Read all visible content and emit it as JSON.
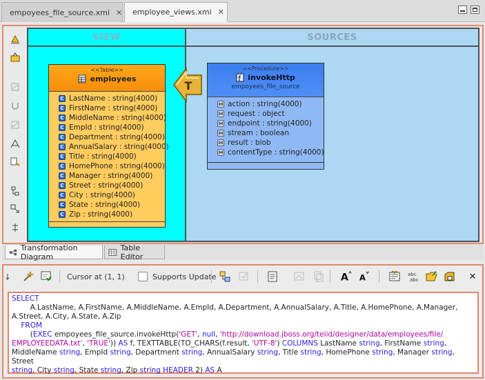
{
  "editor_tabs": [
    {
      "label": "empoyees_file_source.xmi",
      "active": false
    },
    {
      "label": "employee_views.xmi",
      "active": true
    }
  ],
  "diagram": {
    "view_header": "VIEW",
    "sources_header": "SOURCES",
    "table": {
      "stereotype": "<<Table>>",
      "name": "employees",
      "columns": [
        "LastName : string(4000)",
        "FirstName : string(4000)",
        "MiddleName : string(4000)",
        "EmpId : string(4000)",
        "Department : string(4000)",
        "AnnualSalary : string(4000)",
        "Title : string(4000)",
        "HomePhone : string(4000)",
        "Manager : string(4000)",
        "Street : string(4000)",
        "City : string(4000)",
        "State : string(4000)",
        "Zip : string(4000)"
      ]
    },
    "procedure": {
      "stereotype": "<<Procedure>>",
      "name": "invokeHttp",
      "source": "empoyees_file_source",
      "params": [
        "action : string(4000)",
        "request : object",
        "endpoint : string(4000)",
        "stream : boolean",
        "result : blob",
        "contentType : string(4000)"
      ]
    },
    "transform_symbol": "T"
  },
  "diagram_tabs": [
    {
      "label": "Transformation Diagram",
      "active": true
    },
    {
      "label": "Table Editor",
      "active": false
    }
  ],
  "sql_toolbar": {
    "cursor_label": "Cursor at (1, 1)",
    "supports_update_label": "Supports Update",
    "supports_update_checked": false
  },
  "sql": {
    "lines": [
      [
        {
          "t": "SELECT",
          "c": "kw"
        }
      ],
      [
        {
          "t": "        A.LastName, A.FirstName, A.MiddleName, A.EmpId, A.Department, A.AnnualSalary, A.Title, A.HomePhone, A.Manager,",
          "c": ""
        }
      ],
      [
        {
          "t": "A.Street, A.City, A.State, A.Zip",
          "c": ""
        }
      ],
      [
        {
          "t": "    FROM",
          "c": "kw"
        }
      ],
      [
        {
          "t": "        (",
          "c": ""
        },
        {
          "t": "EXEC",
          "c": "kw"
        },
        {
          "t": " empoyees_file_source.invokeHttp(",
          "c": ""
        },
        {
          "t": "'GET'",
          "c": "str"
        },
        {
          "t": ", ",
          "c": ""
        },
        {
          "t": "null",
          "c": "kw"
        },
        {
          "t": ", ",
          "c": ""
        },
        {
          "t": "'http://download.jboss.org/teiid/designer/data/employees/file/",
          "c": "str"
        }
      ],
      [
        {
          "t": "EMPLOYEEDATA.txt'",
          "c": "str"
        },
        {
          "t": ", ",
          "c": ""
        },
        {
          "t": "'TRUE'",
          "c": "str"
        },
        {
          "t": ")) ",
          "c": ""
        },
        {
          "t": "AS",
          "c": "kw"
        },
        {
          "t": " f, TEXTTABLE(TO_CHARS(f.result, ",
          "c": ""
        },
        {
          "t": "'UTF-8'",
          "c": "str"
        },
        {
          "t": ") ",
          "c": ""
        },
        {
          "t": "COLUMNS",
          "c": "kw"
        },
        {
          "t": " LastName ",
          "c": ""
        },
        {
          "t": "string",
          "c": "kw"
        },
        {
          "t": ", FirstName ",
          "c": ""
        },
        {
          "t": "string",
          "c": "kw"
        },
        {
          "t": ",",
          "c": ""
        }
      ],
      [
        {
          "t": "MiddleName ",
          "c": ""
        },
        {
          "t": "string",
          "c": "kw"
        },
        {
          "t": ", EmpId ",
          "c": ""
        },
        {
          "t": "string",
          "c": "kw"
        },
        {
          "t": ", Department ",
          "c": ""
        },
        {
          "t": "string",
          "c": "kw"
        },
        {
          "t": ", AnnualSalary ",
          "c": ""
        },
        {
          "t": "string",
          "c": "kw"
        },
        {
          "t": ", Title ",
          "c": ""
        },
        {
          "t": "string",
          "c": "kw"
        },
        {
          "t": ", HomePhone ",
          "c": ""
        },
        {
          "t": "string",
          "c": "kw"
        },
        {
          "t": ", Manager ",
          "c": ""
        },
        {
          "t": "string",
          "c": "kw"
        },
        {
          "t": ", Street",
          "c": ""
        }
      ],
      [
        {
          "t": "string",
          "c": "kw"
        },
        {
          "t": ", City ",
          "c": ""
        },
        {
          "t": "string",
          "c": "kw"
        },
        {
          "t": ", State ",
          "c": ""
        },
        {
          "t": "string",
          "c": "kw"
        },
        {
          "t": ", Zip ",
          "c": ""
        },
        {
          "t": "string",
          "c": "kw"
        },
        {
          "t": " ",
          "c": ""
        },
        {
          "t": "HEADER",
          "c": "kw"
        },
        {
          "t": " 2) ",
          "c": ""
        },
        {
          "t": "AS",
          "c": "kw"
        },
        {
          "t": " A",
          "c": ""
        }
      ]
    ]
  },
  "colors": {
    "view_area": "#00ffff",
    "sources_area": "#add8f2",
    "table_fill": "#ffcc5e",
    "table_header": "#f79a10",
    "procedure_fill": "#8fb9f4",
    "procedure_header": "#4688f2",
    "focus_border": "#e0876d",
    "sql_keyword": "#2a1be0",
    "sql_string": "#b5009b"
  }
}
